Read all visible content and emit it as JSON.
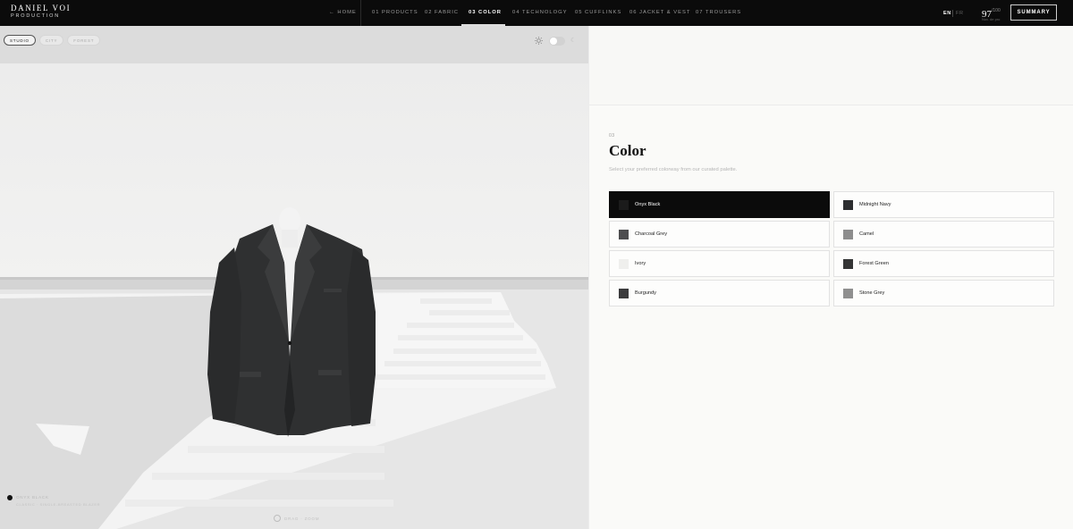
{
  "brand": {
    "name": "DANIEL VOI",
    "sub": "PRODUCTION"
  },
  "nav": {
    "home": "← HOME",
    "items": [
      {
        "label": "01 PRODUCTS"
      },
      {
        "label": "02 FABRIC"
      },
      {
        "label": "03 COLOR"
      },
      {
        "label": "04 TECHNOLOGY"
      },
      {
        "label": "05 CUFFLINKS"
      },
      {
        "label": "06 JACKET & VEST"
      },
      {
        "label": "07 TROUSERS"
      }
    ],
    "active_index": 2
  },
  "language": {
    "en": "EN",
    "fr": "FR"
  },
  "score": {
    "value": "97",
    "unit": "/100",
    "note": "Nov. de pro"
  },
  "summary_label": "SUMMARY",
  "viewer": {
    "environments": [
      "STUDIO",
      "CITY",
      "FOREST"
    ],
    "active_environment": "STUDIO",
    "legend_line1": "ONYX BLACK",
    "legend_line2": "CLASSIC · SINGLE-BREASTED BLAZER",
    "drag_hint": "DRAG · ZOOM"
  },
  "panel": {
    "step": "03",
    "title": "Color",
    "subtitle": "Select your preferred colorway from our curated palette.",
    "options": [
      {
        "label": "Onyx Black",
        "color": "#1b1b1b",
        "selected": true
      },
      {
        "label": "Midnight Navy",
        "color": "#2c2d2f",
        "selected": false
      },
      {
        "label": "Charcoal Grey",
        "color": "#4d4d4f",
        "selected": false
      },
      {
        "label": "Camel",
        "color": "#8d8d8d",
        "selected": false
      },
      {
        "label": "Ivory",
        "color": "#efefed",
        "selected": false
      },
      {
        "label": "Forest Green",
        "color": "#343535",
        "selected": false
      },
      {
        "label": "Burgundy",
        "color": "#3b3b3d",
        "selected": false
      },
      {
        "label": "Stone Grey",
        "color": "#8f8f8f",
        "selected": false
      }
    ]
  }
}
